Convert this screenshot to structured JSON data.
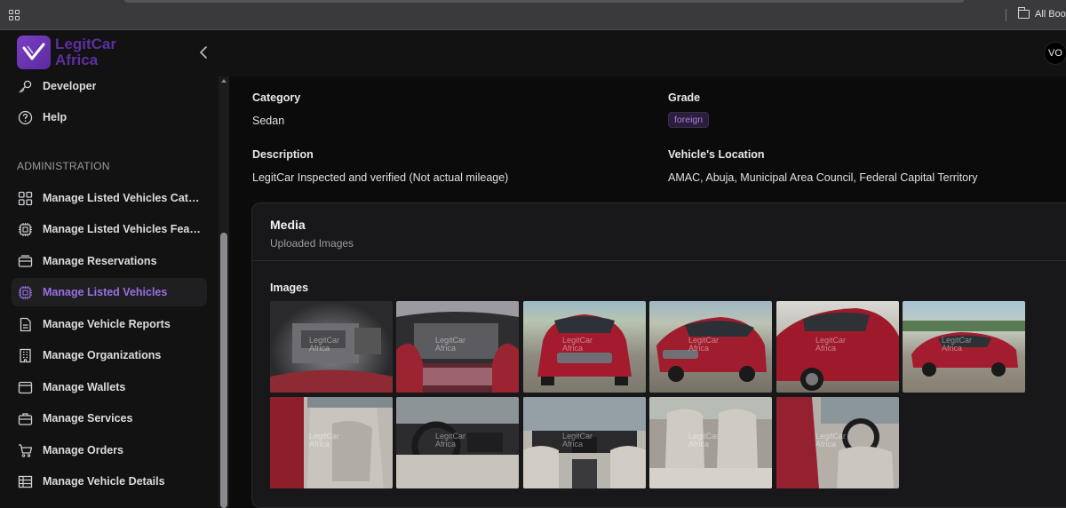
{
  "browser": {
    "bookmarks_label": "All Book"
  },
  "header": {
    "brand_line1": "LegitCar",
    "brand_line2": "Africa",
    "user_initials": "VO"
  },
  "sidebar": {
    "top_items": [
      {
        "label": "Developer",
        "icon": "key-icon"
      },
      {
        "label": "Help",
        "icon": "help-circle-icon"
      }
    ],
    "section_title": "ADMINISTRATION",
    "admin_items": [
      {
        "label": "Manage Listed Vehicles Categ...",
        "icon": "grid-icon"
      },
      {
        "label": "Manage Listed Vehicles Features",
        "icon": "chip-icon"
      },
      {
        "label": "Manage Reservations",
        "icon": "inbox-icon"
      },
      {
        "label": "Manage Listed Vehicles",
        "icon": "chip-icon",
        "active": true
      },
      {
        "label": "Manage Vehicle Reports",
        "icon": "document-icon"
      },
      {
        "label": "Manage Organizations",
        "icon": "building-icon"
      },
      {
        "label": "Manage Wallets",
        "icon": "wallet-icon"
      },
      {
        "label": "Manage Services",
        "icon": "briefcase-icon"
      },
      {
        "label": "Manage Orders",
        "icon": "cart-icon"
      },
      {
        "label": "Manage Vehicle Details",
        "icon": "table-icon"
      }
    ]
  },
  "details": {
    "category_label": "Category",
    "category_value": "Sedan",
    "grade_label": "Grade",
    "grade_value": "foreign",
    "description_label": "Description",
    "description_value": "LegitCar Inspected and verified (Not actual mileage)",
    "location_label": "Vehicle's Location",
    "location_value": "AMAC, Abuja, Municipal Area Council, Federal Capital Territory"
  },
  "media": {
    "title": "Media",
    "subtitle": "Uploaded Images",
    "images_label": "Images",
    "images": [
      {
        "subject": "engine-bay"
      },
      {
        "subject": "engine-bay-open-hood"
      },
      {
        "subject": "front-view"
      },
      {
        "subject": "front-three-quarter-view"
      },
      {
        "subject": "side-view"
      },
      {
        "subject": "rear-side-view"
      },
      {
        "subject": "front-seats-door-open"
      },
      {
        "subject": "dashboard-steering"
      },
      {
        "subject": "dashboard-rear-view"
      },
      {
        "subject": "rear-seats"
      },
      {
        "subject": "driver-door-interior"
      }
    ],
    "watermark_line1": "LegitCar",
    "watermark_line2": "Africa"
  },
  "colors": {
    "accent": "#9a6fe0",
    "brand": "#6a34b4",
    "background": "#0b0b0c",
    "sidebar": "#121213"
  }
}
